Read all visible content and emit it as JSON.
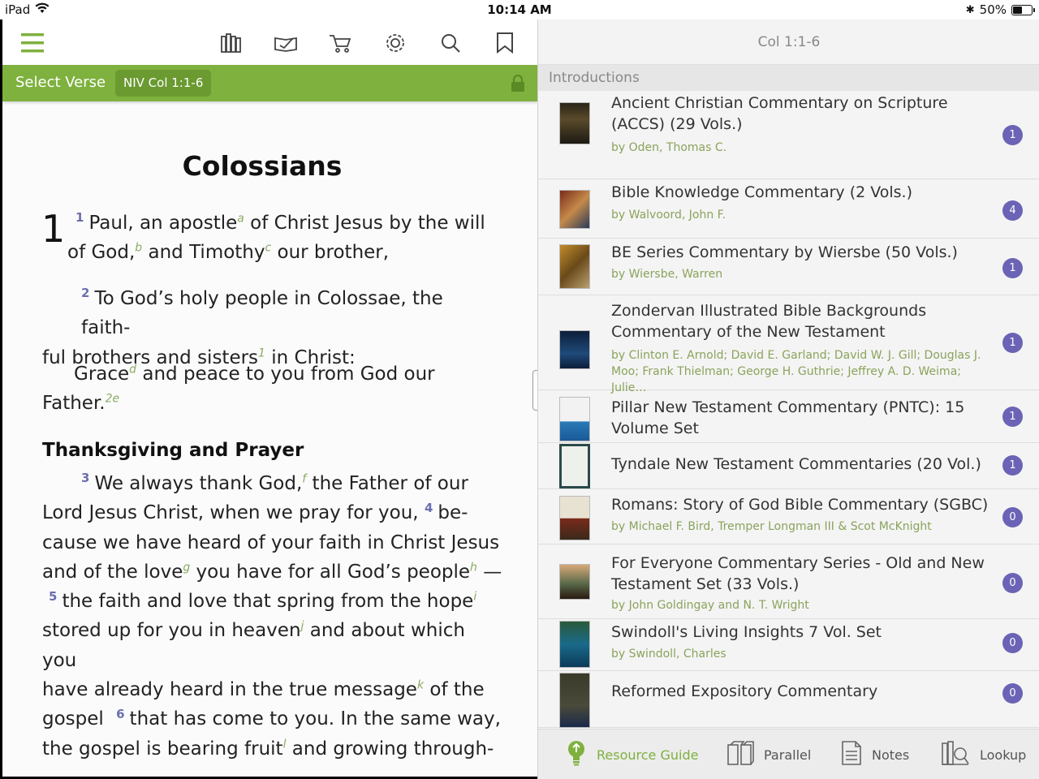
{
  "status_bar": {
    "device": "iPad",
    "time": "10:14 AM",
    "battery": "50%",
    "battery_level": 0.5
  },
  "toolbar": {
    "icons": [
      "menu-icon",
      "library-icon",
      "reading-plan-icon",
      "cart-icon",
      "settings-icon",
      "search-icon",
      "bookmark-icon"
    ]
  },
  "verse_bar": {
    "select_label": "Select Verse",
    "reference": "NIV Col 1:1-6"
  },
  "bible": {
    "book_title": "Colossians",
    "chapter": "1",
    "heading": "Thanksgiving and Prayer",
    "p1": {
      "v1": "1",
      "t1": "Paul, an apostle",
      "f1": "a",
      "t2": " of Christ Jesus by the will",
      "t3": "of God,",
      "f2": "b",
      "t4": " and Timothy",
      "f3": "c",
      "t5": " our brother,"
    },
    "p2": {
      "v2": "2",
      "t1": "To God’s holy people in Colossae, the faith-",
      "t2": "ful brothers and sisters",
      "f1": "1",
      "t3": " in Christ:"
    },
    "p3": {
      "t1": "Grace",
      "f1": "d",
      "t2": " and peace to you from God our",
      "t3": "Father.",
      "f2": "2e"
    },
    "p4": {
      "v3": "3",
      "l1a": "We always thank God,",
      "f1": "f",
      "l1b": " the Father of our",
      "l2a": "Lord Jesus Christ, when we pray for you, ",
      "v4": "4",
      "l2b": "be-",
      "l3": "cause we have heard of your faith in Christ Jesus",
      "l4a": "and of the love",
      "f2": "g",
      "l4b": " you have for all God’s people",
      "f3": "h",
      "l4c": " —",
      "v5": "5",
      "l5a": "the faith and love that spring from the hope",
      "f4": "i",
      "l6a": "stored up for you in heaven",
      "f5": "j",
      "l6b": " and about which you",
      "l7a": "have already heard in the true message",
      "f6": "k",
      "l7b": " of the",
      "l8a": "gospel ",
      "v6": "6",
      "l8b": "that has come to you. In the same way,",
      "l9a": "the gospel is bearing fruit",
      "f7": "l",
      "l9b": " and growing through-"
    }
  },
  "right_pane": {
    "header": "Col 1:1-6",
    "section": "Introductions",
    "resources": [
      {
        "title": "Ancient Christian Commentary on Scripture (ACCS) (29 Vols.)",
        "author": "by Oden, Thomas C.",
        "count": "1"
      },
      {
        "title": "Bible Knowledge Commentary (2 Vols.)",
        "author": "by Walvoord, John F.",
        "count": "4"
      },
      {
        "title": "BE Series Commentary by Wiersbe (50 Vols.)",
        "author": "by Wiersbe, Warren",
        "count": "1"
      },
      {
        "title": "Zondervan Illustrated Bible Backgrounds Commentary of the New Testament",
        "author": "by Clinton E. Arnold; David E. Garland; David W. J. Gill; Douglas J. Moo; Frank Thielman; George H. Guthrie; Jeffrey A. D. Weima; Julie…",
        "count": "1"
      },
      {
        "title": "Pillar New Testament Commentary (PNTC): 15 Volume Set",
        "author": "",
        "count": "1"
      },
      {
        "title": "Tyndale New Testament Commentaries (20 Vol.)",
        "author": "",
        "count": "1"
      },
      {
        "title": "Romans: Story of God Bible Commentary (SGBC)",
        "author": "by Michael F. Bird, Tremper Longman III & Scot McKnight",
        "count": "0"
      },
      {
        "title": "For Everyone Commentary Series - Old and New Testament Set (33 Vols.)",
        "author": "by John Goldingay and N. T. Wright",
        "count": "0"
      },
      {
        "title": "Swindoll's Living Insights 7 Vol. Set",
        "author": "by Swindoll, Charles",
        "count": "0"
      },
      {
        "title": "Reformed Expository Commentary",
        "author": "",
        "count": "0"
      }
    ],
    "bottom_bar": [
      {
        "label": "Resource Guide",
        "icon": "lightbulb-icon"
      },
      {
        "label": "Parallel",
        "icon": "parallel-books-icon"
      },
      {
        "label": "Notes",
        "icon": "notes-icon"
      },
      {
        "label": "Lookup",
        "icon": "lookup-icon"
      }
    ]
  },
  "colors": {
    "accent_green": "#7eb13e",
    "badge_purple": "#6b63b5",
    "verse_number": "#6b6fb0",
    "footnote": "#8aab62"
  }
}
